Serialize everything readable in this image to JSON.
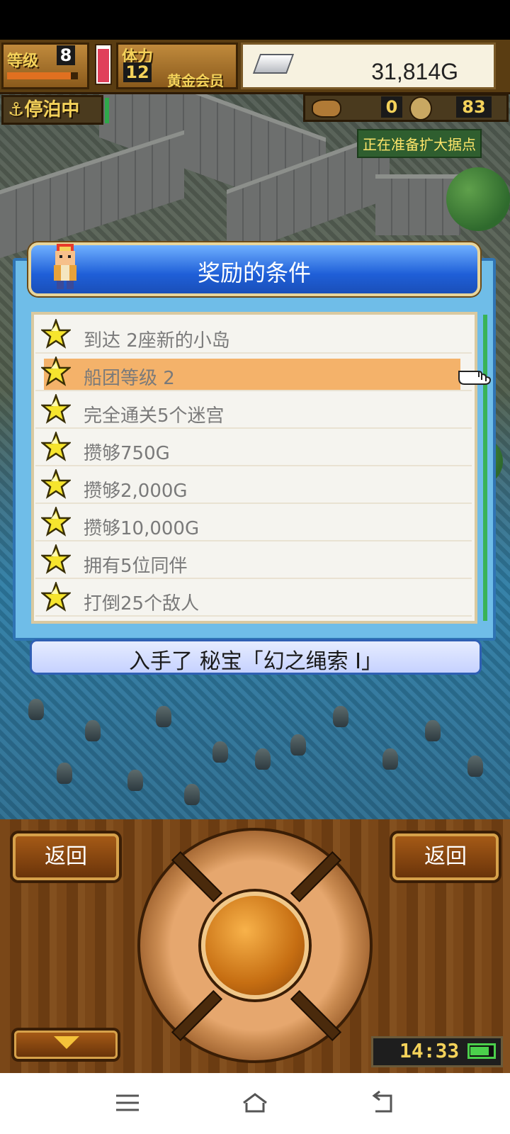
{
  "hud": {
    "level_label": "等级",
    "level": "8",
    "level_progress": 0.9,
    "stamina_label": "体力",
    "stamina": "12",
    "stamina_gauge": 0.95,
    "membership": "黄金会员",
    "gold": "31,814G",
    "dock_status": "停泊中",
    "resource_a": "0",
    "resource_b": "83",
    "expand_status": "正在准备扩大据点"
  },
  "dialog": {
    "title": "奖励的条件",
    "conditions": [
      {
        "label": "到达 2座新的小岛",
        "selected": false
      },
      {
        "label": "船团等级 2",
        "selected": true
      },
      {
        "label": "完全通关5个迷宫",
        "selected": false
      },
      {
        "label": "攒够750G",
        "selected": false
      },
      {
        "label": "攒够2,000G",
        "selected": false
      },
      {
        "label": "攒够10,000G",
        "selected": false
      },
      {
        "label": "拥有5位同伴",
        "selected": false
      },
      {
        "label": "打倒25个敌人",
        "selected": false
      }
    ],
    "reward": "入手了 秘宝「幻之绳索 Ⅰ」"
  },
  "controls": {
    "back_left": "返回",
    "back_right": "返回",
    "clock": "14:33"
  },
  "navbar": {
    "icons": [
      "menu-icon",
      "home-icon",
      "back-icon"
    ]
  }
}
